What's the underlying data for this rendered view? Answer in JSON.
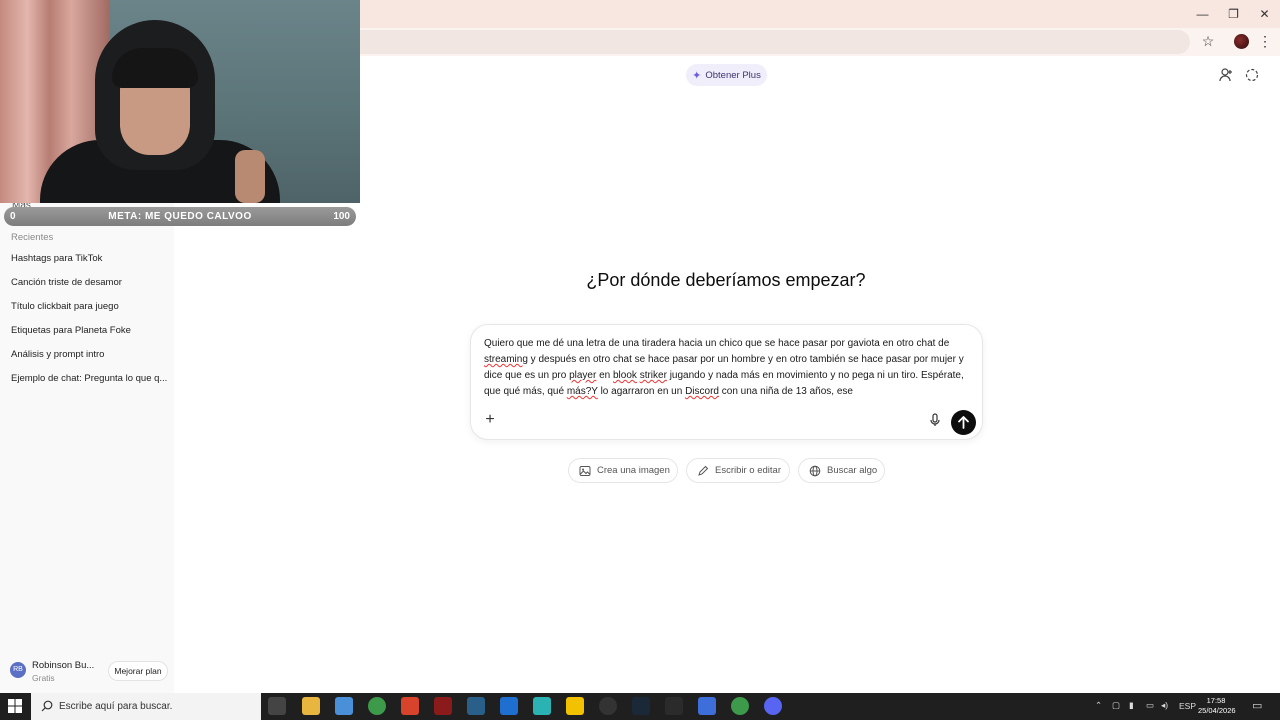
{
  "browser": {
    "window_controls": {
      "minimize": "—",
      "restore": "❐",
      "close": "✕"
    }
  },
  "sidebar": {
    "more_label": "Más",
    "recents_title": "Recientes",
    "recents": [
      "Hashtags para TikTok",
      "Canción triste de desamor",
      "Título clickbait para juego",
      "Etiquetas para Planeta Foke",
      "Análisis y prompt intro",
      "Ejemplo de chat: Pregunta lo que q..."
    ],
    "user": {
      "initials": "RB",
      "name": "Robinson Bu...",
      "plan": "Gratis",
      "upgrade_label": "Mejorar plan"
    }
  },
  "header": {
    "plus_label": "Obtener Plus"
  },
  "main": {
    "headline": "¿Por dónde deberíamos empezar?",
    "prompt": {
      "p1": "Quiero que me dé una letra de una tiradera hacia un chico que se hace pasar por gaviota en otro chat de ",
      "w1": "streaming",
      "p2": " y después en otro chat se hace pasar por un hombre y en otro también se hace pasar por mujer y dice que es un pro ",
      "w2": "player",
      "p3": " en ",
      "w3": "blook",
      "p4": " ",
      "w4": "striker",
      "p5": " jugando y nada más en movimiento y no pega ni un tiro. Espérate, que qué más, qué ",
      "w5": "más?Y",
      "p6": " lo agarraron en un ",
      "w6": "Discord",
      "p7": " con una niña de 13 años, ese"
    },
    "chips": [
      {
        "label": "Crea una imagen",
        "icon": "image-icon"
      },
      {
        "label": "Escribir o editar",
        "icon": "pencil-icon"
      },
      {
        "label": "Buscar algo",
        "icon": "globe-icon"
      }
    ]
  },
  "stream_overlay": {
    "goal_label": "META: ME QUEDO CALVOO",
    "goal_min": "0",
    "goal_max": "100",
    "goal_progress": 0.0
  },
  "taskbar": {
    "search_placeholder": "Escribe aquí para buscar.",
    "language": "ESP",
    "time": "17:58",
    "date": "25/04/2026"
  },
  "colors": {
    "accent": "#6b5ce7",
    "send_button": "#0d0d0d",
    "sidebar_bg": "#f9f9f9",
    "tabbar_bg": "#f8e7e1"
  }
}
